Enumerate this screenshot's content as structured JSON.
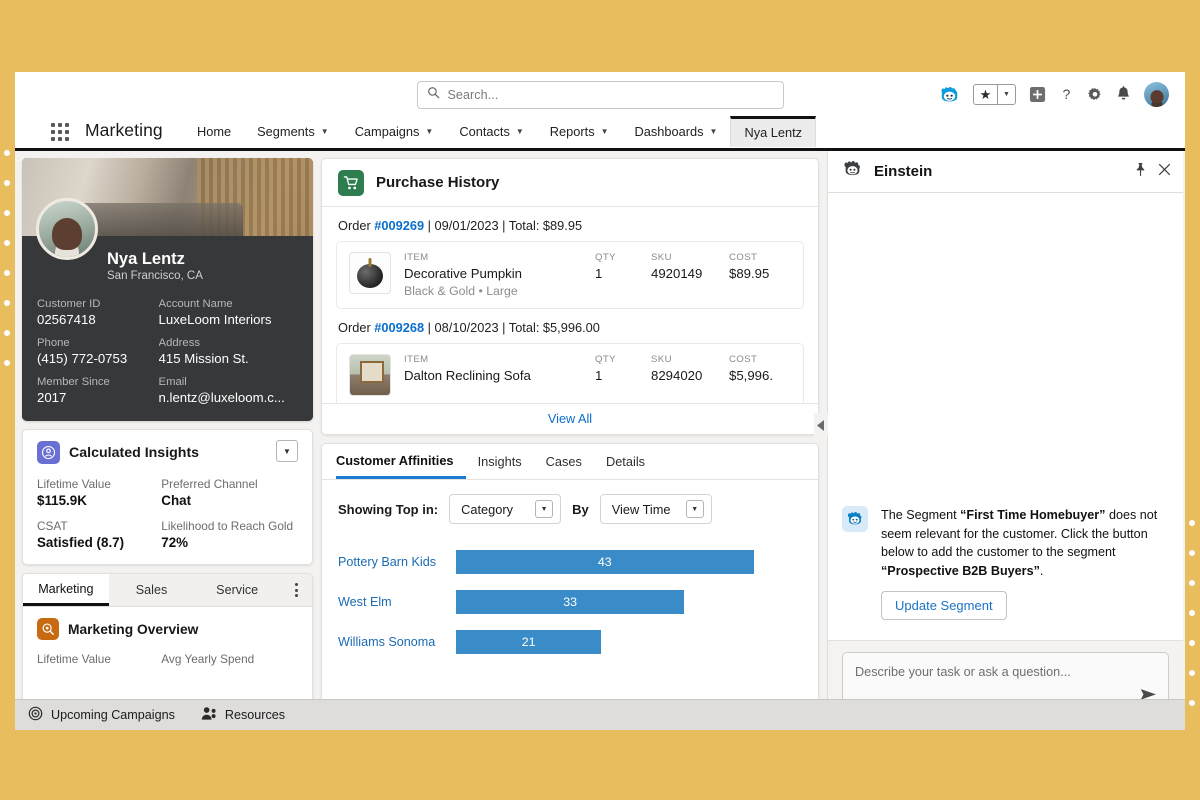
{
  "header": {
    "search_placeholder": "Search...",
    "icons": [
      "einstein-icon",
      "favorites-star-icon",
      "favorites-caret-icon",
      "new-item-icon",
      "help-icon",
      "setup-gear-icon",
      "notifications-bell-icon",
      "user-avatar"
    ]
  },
  "appnav": {
    "app_name": "Marketing",
    "items": [
      {
        "label": "Home",
        "caret": false,
        "active": false
      },
      {
        "label": "Segments",
        "caret": true,
        "active": false
      },
      {
        "label": "Campaigns",
        "caret": true,
        "active": false
      },
      {
        "label": "Contacts",
        "caret": true,
        "active": false
      },
      {
        "label": "Reports",
        "caret": true,
        "active": false
      },
      {
        "label": "Dashboards",
        "caret": true,
        "active": false
      },
      {
        "label": "Nya Lentz",
        "caret": false,
        "active": true
      }
    ]
  },
  "profile": {
    "name": "Nya Lentz",
    "location": "San Francisco, CA",
    "fields": [
      {
        "label": "Customer ID",
        "value": "02567418"
      },
      {
        "label": "Account Name",
        "value": "LuxeLoom Interiors"
      },
      {
        "label": "Phone",
        "value": "(415) 772-0753"
      },
      {
        "label": "Address",
        "value": "415 Mission St."
      },
      {
        "label": "Member Since",
        "value": "2017"
      },
      {
        "label": "Email",
        "value": "n.lentz@luxeloom.c..."
      }
    ]
  },
  "calculated_insights": {
    "title": "Calculated Insights",
    "items": [
      {
        "label": "Lifetime Value",
        "value": "$115.9K"
      },
      {
        "label": "Preferred Channel",
        "value": "Chat"
      },
      {
        "label": "CSAT",
        "value": "Satisfied (8.7)"
      },
      {
        "label": "Likelihood to Reach Gold",
        "value": "72%"
      }
    ]
  },
  "mini_tabs": {
    "tabs": [
      {
        "label": "Marketing",
        "active": true
      },
      {
        "label": "Sales",
        "active": false
      },
      {
        "label": "Service",
        "active": false
      }
    ],
    "overview_title": "Marketing Overview",
    "overview_labels": [
      "Lifetime Value",
      "Avg Yearly Spend"
    ]
  },
  "purchase_history": {
    "title": "Purchase History",
    "view_all": "View All",
    "orders": [
      {
        "prefix": "Order ",
        "id": "#009269",
        "meta": " | 09/01/2023 | Total: $89.95",
        "columns": [
          "ITEM",
          "QTY",
          "SKU",
          "COST"
        ],
        "item": "Decorative Pumpkin",
        "subtitle": "Black & Gold • Large",
        "qty": "1",
        "sku": "4920149",
        "cost": "$89.95",
        "thumb": "pumpkin-thumbnail"
      },
      {
        "prefix": "Order ",
        "id": "#009268",
        "meta": " | 08/10/2023 | Total: $5,996.00",
        "columns": [
          "ITEM",
          "QTY",
          "SKU",
          "COST"
        ],
        "item": "Dalton Reclining Sofa",
        "subtitle": "",
        "qty": "1",
        "sku": "8294020",
        "cost": "$5,996.",
        "thumb": "sofa-thumbnail"
      }
    ]
  },
  "affinities": {
    "tabs": [
      {
        "label": "Customer Affinities",
        "active": true
      },
      {
        "label": "Insights",
        "active": false
      },
      {
        "label": "Cases",
        "active": false
      },
      {
        "label": "Details",
        "active": false
      }
    ],
    "showing_label": "Showing Top in:",
    "showing_value": "Category",
    "by_label": "By",
    "by_value": "View Time"
  },
  "chart_data": {
    "type": "bar",
    "orientation": "horizontal",
    "title": "Customer Affinities",
    "categories": [
      "Pottery Barn Kids",
      "West Elm",
      "Williams Sonoma"
    ],
    "values": [
      43,
      33,
      21
    ],
    "xlabel": "",
    "ylabel": "",
    "xlim": [
      0,
      50
    ],
    "grid": false,
    "legend": false,
    "bar_color": "#3a8cc8",
    "label_color": "#1b6bb3"
  },
  "einstein": {
    "title": "Einstein",
    "message_parts": [
      {
        "text": "The Segment ",
        "bold": false
      },
      {
        "text": "“First Time Homebuyer”",
        "bold": true
      },
      {
        "text": " does not seem relevant for the customer. Click the button below to add the customer to the segment ",
        "bold": false
      },
      {
        "text": "“Prospective B2B Buyers”",
        "bold": true
      },
      {
        "text": ".",
        "bold": false
      }
    ],
    "message_plain": "The Segment “First Time Homebuyer” does not seem relevant for the customer. Click the button below to add the customer to the segment “Prospective B2B Buyers”.",
    "update_button": "Update Segment",
    "composer_placeholder": "Describe your task or ask a question..."
  },
  "utility_bar": {
    "items": [
      {
        "label": "Upcoming Campaigns",
        "icon": "target-icon"
      },
      {
        "label": "Resources",
        "icon": "people-icon"
      }
    ]
  },
  "colors": {
    "frame": "#e8bd5e",
    "accent_blue": "#0b6ecb",
    "bar_blue": "#3a8cc8",
    "profile_dark": "#36383a",
    "cart_green": "#2e7d4f",
    "insight_purple": "#6a6fd4",
    "marketing_orange": "#c76a12"
  }
}
